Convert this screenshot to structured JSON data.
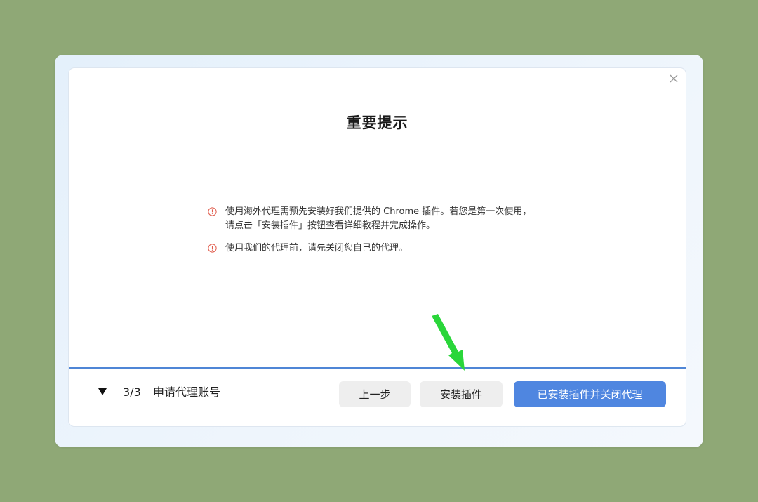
{
  "dialog": {
    "title": "重要提示",
    "close_icon": "close-icon",
    "notices": [
      {
        "icon": "info-circle-icon",
        "lines": [
          "使用海外代理需预先安装好我们提供的 Chrome 插件。若您是第一次使用，",
          "请点击「安装插件」按钮查看详细教程并完成操作。"
        ]
      },
      {
        "icon": "info-circle-icon",
        "lines": [
          "使用我们的代理前，请先关闭您自己的代理。"
        ]
      }
    ]
  },
  "progress": {
    "fraction": 1.0
  },
  "footer": {
    "toggle_icon": "triangle-down-icon",
    "step_count": "3/3",
    "step_name": "申请代理账号",
    "prev_label": "上一步",
    "install_label": "安装插件",
    "confirm_label": "已安装插件并关闭代理"
  },
  "colors": {
    "background": "#8fa876",
    "accent": "#4f86e0",
    "warning": "#e05a4a",
    "annotation_arrow": "#2ad63a"
  }
}
